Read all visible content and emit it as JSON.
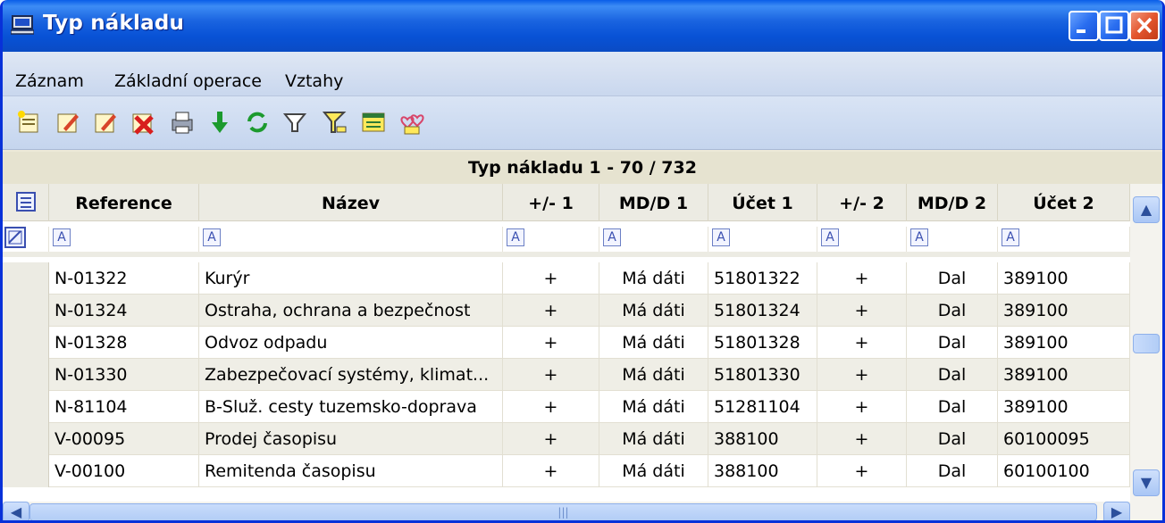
{
  "window": {
    "title": "Typ nákladu"
  },
  "menu": {
    "items": [
      "Záznam",
      "Základní operace",
      "Vztahy"
    ]
  },
  "toolbar": {
    "icons": [
      "new-record-icon",
      "edit-icon",
      "edit-copy-icon",
      "delete-icon",
      "print-icon",
      "download-icon",
      "refresh-icon",
      "filter-icon",
      "filter-advanced-icon",
      "relations-icon",
      "hearts-icon"
    ]
  },
  "grid": {
    "caption": "Typ nákladu  1 - 70 / 732",
    "columns": [
      "Reference",
      "Název",
      "+/- 1",
      "MD/D 1",
      "Účet 1",
      "+/- 2",
      "MD/D 2",
      "Účet 2"
    ],
    "filter_icon_glyph": "A",
    "rows": [
      [
        "N-01322",
        "Kurýr",
        "+",
        "Má dáti",
        "51801322",
        "+",
        "Dal",
        "389100"
      ],
      [
        "N-01324",
        "Ostraha, ochrana a bezpečnost",
        "+",
        "Má dáti",
        "51801324",
        "+",
        "Dal",
        "389100"
      ],
      [
        "N-01328",
        "Odvoz odpadu",
        "+",
        "Má dáti",
        "51801328",
        "+",
        "Dal",
        "389100"
      ],
      [
        "N-01330",
        "Zabezpečovací systémy, klimat...",
        "+",
        "Má dáti",
        "51801330",
        "+",
        "Dal",
        "389100"
      ],
      [
        "N-81104",
        "B-Služ. cesty tuzemsko-doprava",
        "+",
        "Má dáti",
        "51281104",
        "+",
        "Dal",
        "389100"
      ],
      [
        "V-00095",
        "Prodej časopisu",
        "+",
        "Má dáti",
        "388100",
        "+",
        "Dal",
        "60100095"
      ],
      [
        "V-00100",
        "Remitenda časopisu",
        "+",
        "Má dáti",
        "388100",
        "+",
        "Dal",
        "60100100"
      ]
    ]
  },
  "colors": {
    "title_bar": "#0a5ee8",
    "close_button": "#e3562e",
    "header_bg": "#ecebe3",
    "alt_row": "#efeee6"
  }
}
